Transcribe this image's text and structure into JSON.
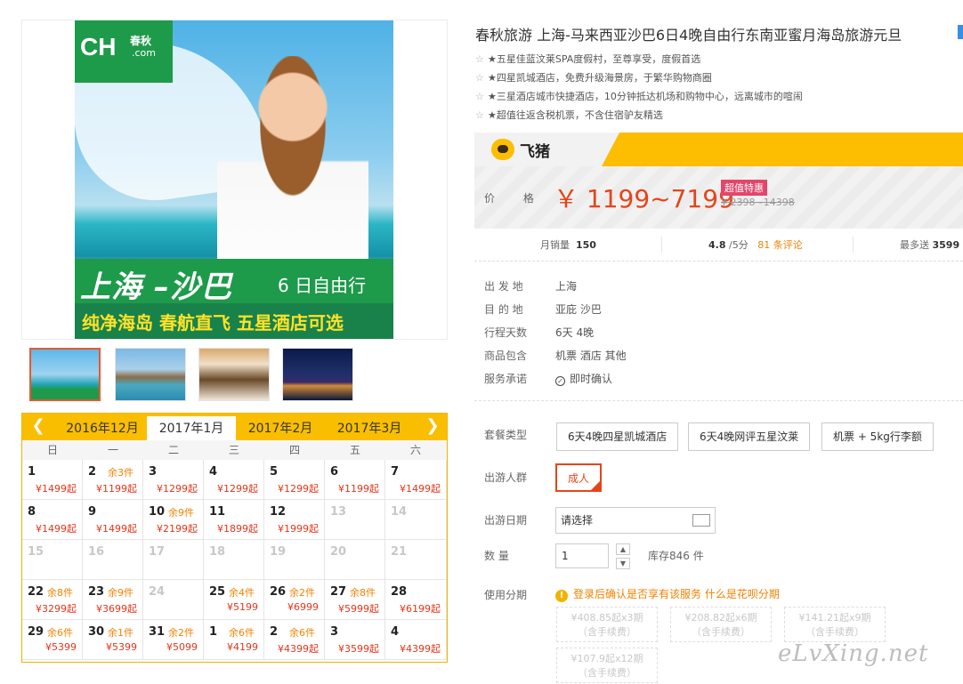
{
  "gallery": {
    "logo_text": "CH",
    "logo_cn": "春秋",
    "logo_com": ".com",
    "banner_title": "上海 –沙巴",
    "banner_sub": "6 日自由行",
    "banner_slogan": "纯净海岛  春航直飞  五星酒店可选"
  },
  "calendar": {
    "prev_icon": "chevron-left-icon",
    "next_icon": "chevron-right-icon",
    "months": [
      "2016年12月",
      "2017年1月",
      "2017年2月",
      "2017年3月"
    ],
    "active_month": "2017年1月",
    "weekdays": [
      "日",
      "一",
      "二",
      "三",
      "四",
      "五",
      "六"
    ],
    "weeks": [
      [
        {
          "d": "1",
          "r": "",
          "p": "¥1499起"
        },
        {
          "d": "2",
          "r": "余3件",
          "p": "¥1199起"
        },
        {
          "d": "3",
          "r": "",
          "p": "¥1299起"
        },
        {
          "d": "4",
          "r": "",
          "p": "¥1299起"
        },
        {
          "d": "5",
          "r": "",
          "p": "¥1299起"
        },
        {
          "d": "6",
          "r": "",
          "p": "¥1199起"
        },
        {
          "d": "7",
          "r": "",
          "p": "¥1499起"
        }
      ],
      [
        {
          "d": "8",
          "r": "",
          "p": "¥1499起"
        },
        {
          "d": "9",
          "r": "",
          "p": "¥1499起"
        },
        {
          "d": "10",
          "r": "余9件",
          "p": "¥2199起"
        },
        {
          "d": "11",
          "r": "",
          "p": "¥1899起"
        },
        {
          "d": "12",
          "r": "",
          "p": "¥1999起"
        },
        {
          "d": "13",
          "r": "",
          "p": "",
          "dim": true
        },
        {
          "d": "14",
          "r": "",
          "p": "",
          "dim": true
        }
      ],
      [
        {
          "d": "15",
          "r": "",
          "p": "",
          "dim": true
        },
        {
          "d": "16",
          "r": "",
          "p": "",
          "dim": true
        },
        {
          "d": "17",
          "r": "",
          "p": "",
          "dim": true
        },
        {
          "d": "18",
          "r": "",
          "p": "",
          "dim": true
        },
        {
          "d": "19",
          "r": "",
          "p": "",
          "dim": true
        },
        {
          "d": "20",
          "r": "",
          "p": "",
          "dim": true
        },
        {
          "d": "21",
          "r": "",
          "p": "",
          "dim": true
        }
      ],
      [
        {
          "d": "22",
          "r": "余8件",
          "p": "¥3299起"
        },
        {
          "d": "23",
          "r": "余9件",
          "p": "¥3699起"
        },
        {
          "d": "24",
          "r": "",
          "p": "",
          "dim": true
        },
        {
          "d": "25",
          "r": "余4件",
          "p": "¥5199"
        },
        {
          "d": "26",
          "r": "余2件",
          "p": "¥6999"
        },
        {
          "d": "27",
          "r": "余8件",
          "p": "¥5999起"
        },
        {
          "d": "28",
          "r": "",
          "p": "¥6199起"
        }
      ],
      [
        {
          "d": "29",
          "r": "余6件",
          "p": "¥5399"
        },
        {
          "d": "30",
          "r": "余1件",
          "p": "¥5399"
        },
        {
          "d": "31",
          "r": "余2件",
          "p": "¥5099"
        },
        {
          "d": "1",
          "r": "余6件",
          "p": "¥4199"
        },
        {
          "d": "2",
          "r": "余6件",
          "p": "¥4399起"
        },
        {
          "d": "3",
          "r": "",
          "p": "¥3599起"
        },
        {
          "d": "4",
          "r": "",
          "p": "¥4399起"
        }
      ]
    ]
  },
  "product": {
    "title": "春秋旅游 上海-马来西亚沙巴6日4晚自由行东南亚蜜月海岛旅游元旦",
    "features": [
      "★五星佳蓝汶莱SPA度假村，至尊享受，度假首选",
      "★四星凯城酒店，免费升级海景房，于繁华购物商圈",
      "★三星酒店城市快捷酒店，10分钟抵达机场和购物中心，远离城市的喧闹",
      "★超值往返含税机票，不含住宿驴友精选"
    ],
    "brand": "飞猪",
    "price_label": "价  格",
    "price": "￥ 1199~7199",
    "price_tag": "超值特惠",
    "price_old": "¥ 2398~14398",
    "stats": {
      "sales_label": "月销量",
      "sales_value": "150",
      "rating": "4.8",
      "rating_suffix": "/5分",
      "reviews_count": "81",
      "reviews_label": "条评论",
      "points_label": "最多送",
      "points_value": "3599"
    },
    "info": [
      {
        "label": "出 发 地",
        "value": "上海"
      },
      {
        "label": "目 的 地",
        "value": "亚庇  沙巴"
      },
      {
        "label": "行程天数",
        "value": "6天 4晚"
      },
      {
        "label": "商品包含",
        "value": "机票  酒店  其他"
      },
      {
        "label": "服务承诺",
        "value": "即时确认"
      }
    ]
  },
  "options": {
    "package_label": "套餐类型",
    "packages": [
      "6天4晚四星凯城酒店",
      "6天4晚网评五星汶莱",
      "机票 + 5kg行李额"
    ],
    "crowd_label": "出游人群",
    "crowd_value": "成人",
    "date_label": "出游日期",
    "date_placeholder": "请选择",
    "qty_label": "数    量",
    "qty_value": "1",
    "stock": "库存846 件",
    "install_label": "使用分期",
    "install_note_1": "登录后确认是否享有该服务",
    "install_note_2": "什么是花呗分期",
    "installments": [
      {
        "line1": "¥408.85起x3期",
        "line2": "（含手续费）"
      },
      {
        "line1": "¥208.82起x6期",
        "line2": "（含手续费）"
      },
      {
        "line1": "¥141.21起x9期",
        "line2": "（含手续费）"
      },
      {
        "line1": "¥107.9起x12期",
        "line2": "（含手续费）"
      }
    ]
  },
  "watermark": "eLvXing.net"
}
